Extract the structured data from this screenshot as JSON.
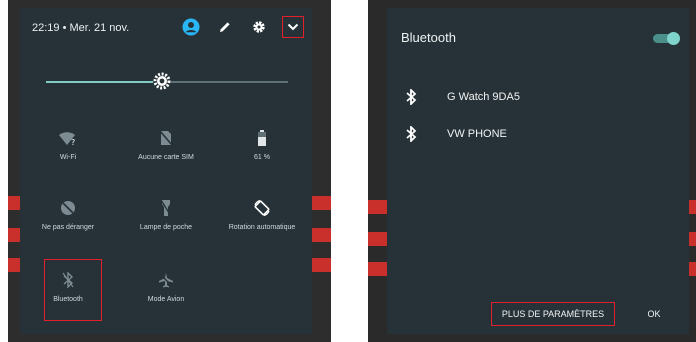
{
  "left_panel": {
    "time": "22:19",
    "separator": "•",
    "date": "Mer. 21 nov.",
    "header_icons": [
      "account-icon",
      "pencil-icon",
      "gear-icon",
      "chevron-down-icon"
    ],
    "brightness_level_fraction": 0.48,
    "tiles": [
      {
        "label": "Wi-Fi",
        "icon": "wifi-question-icon"
      },
      {
        "label": "Aucune carte SIM",
        "icon": "no-sim-icon"
      },
      {
        "label": "61 %",
        "icon": "battery-icon"
      },
      {
        "label": "Ne pas déranger",
        "icon": "do-not-disturb-icon"
      },
      {
        "label": "Lampe de poche",
        "icon": "flashlight-icon"
      },
      {
        "label": "Rotation automatique",
        "icon": "auto-rotate-icon"
      },
      {
        "label": "Bluetooth",
        "icon": "bluetooth-off-icon"
      },
      {
        "label": "Mode Avion",
        "icon": "airplane-off-icon"
      }
    ]
  },
  "bluetooth_dialog": {
    "title": "Bluetooth",
    "toggle_on": true,
    "devices": [
      {
        "name": "G Watch 9DA5",
        "icon": "bluetooth-icon"
      },
      {
        "name": "VW PHONE",
        "icon": "bluetooth-icon"
      }
    ],
    "more_settings_label": "PLUS DE PARAMÈTRES",
    "ok_label": "OK"
  },
  "colors": {
    "panel": "#263238",
    "accent": "#80cbc4",
    "highlight": "#e0212b"
  }
}
